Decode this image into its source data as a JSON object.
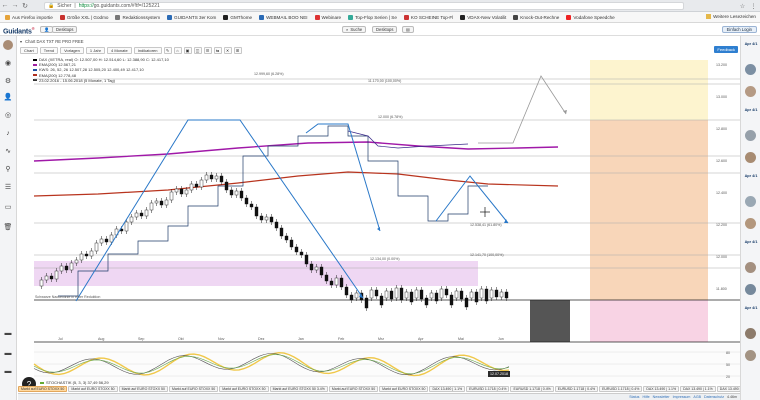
{
  "browser": {
    "secure_label": "Sicher",
    "url_scheme": "https://",
    "url_rest": "go.guidants.com/#!tf=/125221",
    "bookmarks": [
      "Aus Firefox importie",
      "Größe XXL | Godmo",
      "Redaktionssystem",
      "GUIDANTS 3er Kom",
      "GMThome",
      "WEBMAIL BOO NEI",
      "Webinare",
      "Top-Flop Serien | Se",
      "KO SCHEINE Top-Fl",
      "VDAX-New Volatilit",
      "Knock-Out-Rechne",
      "Vodafone Speedche"
    ],
    "bookmarks_right": "Weitere Lesezeichen"
  },
  "app": {
    "logo": "Guidants",
    "logo_suffix": "®",
    "btn_desktops": "Desktops",
    "search_label": "Suche",
    "btn_center": "Desktops",
    "share_label": "Einfach Login"
  },
  "chart_panel": {
    "title": "Chart DAX TXT RE PRO FREE",
    "toolbar": [
      "Chart",
      "Trend",
      "Vorlagen",
      "1 Jahr",
      "4 Monate",
      "Indikatoren"
    ],
    "toolbar_right": "Feedback",
    "legend": [
      {
        "text": "DAX (XETRA, real) O: 12.507,00 H: 12.514,60 L: 12.388,90 C: 12.417,10",
        "color": "#000000"
      },
      {
        "text": "EMA(200)  12.567,21",
        "color": "#a020a0"
      },
      {
        "text": "KWS: 26, 52, 26  12.507,28  12.505,20  12.400,49  12.417,10",
        "color": "#1f4fa0"
      },
      {
        "text": "EMA(200)  12.778,48",
        "color": "#b03020"
      },
      {
        "text": "23.02.2016 - 15.06.2018 (5 Monate, 1 Tag)",
        "color": "#333333"
      }
    ],
    "price_labels": [
      "12.999,60 (6.28%)",
      "11.170,00 (100,00%)",
      "12.000 (6.78%)",
      "12.538,41 (61.80%)",
      "12.141,70 (100,00%)",
      "12.134,00 (0.00%)"
    ],
    "x_ticks": [
      "Jul",
      "Aug",
      "Sep",
      "Okt",
      "Nov",
      "Dez",
      "Jan",
      "Feb",
      "Mrz",
      "Apr",
      "Mai",
      "Jun"
    ],
    "resistance_note": "Schwarze Nackenlinie in einer Reduktion",
    "date_badge": "12.07.2018",
    "osc_legend": "STOCHASTIK (5, 3, 3) 37,49  56,29",
    "y_price_marks": [
      "13.200",
      "13.000",
      "12.800",
      "12.600",
      "12.400",
      "12.200",
      "12.000",
      "11.800"
    ],
    "osc_y": [
      "80",
      "50",
      "20"
    ]
  },
  "bottom_tabs": [
    "Markt auf EURO STOXX 50",
    "Markt auf EURO STOXX 50",
    "Markt auf EURO STOXX 50",
    "Markt auf EURO STOXX 50",
    "Markt auf EURO STOXX 50",
    "Markt auf EURO STOXX 50 3.4%",
    "Markt auf EURO STOXX 50",
    "Markt auf EURO STOXX 50",
    "DAX 13.490 | 1.1%",
    "EURUSD 1.1718 | 0.4%",
    "EURUSD 1.1718 | 0.4%",
    "EURUSD 1.1718 | 0.4%",
    "EURUSD 1.1718 | 0.4%",
    "DAX 13.490 | 1.1%",
    "DAX 13.490 | 1.1%",
    "DAX 13.490 | 1.1%"
  ],
  "status": {
    "items": [
      "Status",
      "Hilfe",
      "Newsletter",
      "Impressum",
      "AGB",
      "Datenschutz"
    ],
    "version": "4.46m"
  },
  "colors": {
    "kw_blue": "#2a78c8",
    "ema_purple": "#a018a8",
    "ema_red": "#b8341e",
    "zone_yellow": "#fdf4cf",
    "zone_orange": "#f8d6b9",
    "zone_pink": "#f8d3e4",
    "zone_lilac": "#efd7f3"
  }
}
